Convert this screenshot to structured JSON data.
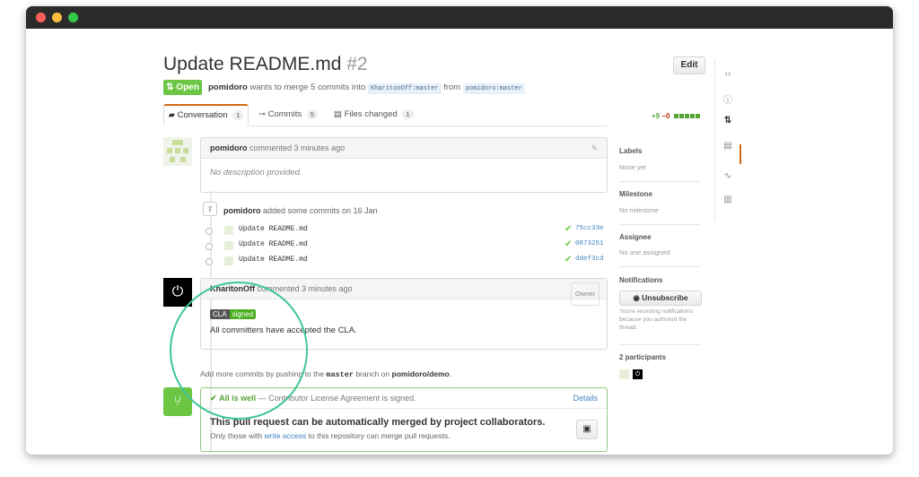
{
  "window": {
    "colors": {
      "titlebar": "#2b2b2b",
      "accent": "#d26911",
      "green": "#6cc644",
      "link": "#4183c4"
    }
  },
  "pr": {
    "title": "Update README.md",
    "number": "#2",
    "edit_label": "Edit",
    "state": "Open",
    "author": "pomidoro",
    "merge_text": "wants to merge 5 commits into",
    "base_branch": "KharitonOff:master",
    "from_text": "from",
    "head_branch": "pomidoro:master"
  },
  "tabs": [
    {
      "icon": "conversation-icon",
      "label": "Conversation",
      "count": "1"
    },
    {
      "icon": "commit-icon",
      "label": "Commits",
      "count": "5"
    },
    {
      "icon": "file-diff-icon",
      "label": "Files changed",
      "count": "1"
    }
  ],
  "diffstat": {
    "additions": "+9",
    "deletions": "−0",
    "blocks": 5
  },
  "comment1": {
    "author": "pomidoro",
    "time": "commented 3 minutes ago",
    "body": "No description provided."
  },
  "commits": {
    "author": "pomidoro",
    "text": "added some commits on 16 Jan",
    "items": [
      {
        "message": "Update README.md",
        "sha": "75cc33e"
      },
      {
        "message": "Update README.md",
        "sha": "0873251"
      },
      {
        "message": "Update README.md",
        "sha": "ddef3cd"
      }
    ]
  },
  "comment2": {
    "author": "KharitonOff",
    "time": "commented 3 minutes ago",
    "owner": "Owner",
    "cla_label": "CLA",
    "cla_status": "signed",
    "body": "All committers have accepted the CLA."
  },
  "help": {
    "prefix": "Add more commits by pushing to the",
    "branch": "master",
    "middle": "branch on",
    "repo": "pomidoro/demo",
    "suffix": "."
  },
  "merge": {
    "status_ok": "All is well",
    "status_text": "— Contributor License Agreement is signed.",
    "details": "Details",
    "title": "This pull request can be automatically merged by project collaborators.",
    "sub_prefix": "Only those with",
    "sub_link": "write access",
    "sub_suffix": "to this repository can merge pull requests."
  },
  "sidebar": {
    "labels_title": "Labels",
    "labels_value": "None yet",
    "milestone_title": "Milestone",
    "milestone_value": "No milestone",
    "assignee_title": "Assignee",
    "assignee_value": "No one assigned",
    "notifications_title": "Notifications",
    "unsubscribe_label": "Unsubscribe",
    "notifications_note": "You're receiving notifications because you authored the thread.",
    "participants_title": "2 participants"
  },
  "rail": [
    "code-icon",
    "issues-icon",
    "pull-request-icon",
    "wiki-icon",
    "pulse-icon",
    "graphs-icon"
  ]
}
